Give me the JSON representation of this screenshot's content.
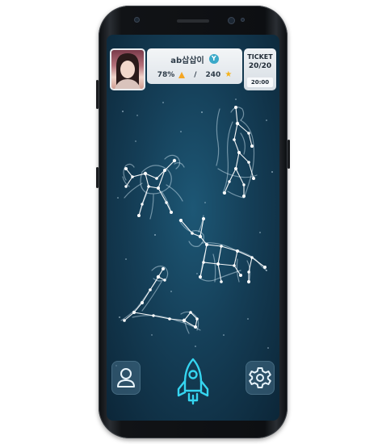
{
  "user": {
    "name": "ab삽삽이",
    "badge_letter": "Y",
    "percent": "78%",
    "separator": "/",
    "stars": "240"
  },
  "ticket": {
    "title": "TICKET",
    "count": "20/20",
    "timer": "20:00"
  },
  "constellations": [
    "cancer-constellation",
    "virgo-constellation",
    "taurus-constellation",
    "sagittarius-constellation"
  ],
  "bottom_nav": {
    "left_icon": "user-icon",
    "center_icon": "rocket-icon",
    "right_icon": "gear-icon"
  },
  "colors": {
    "accent": "#35d5f0",
    "star_gold": "#f5b21a",
    "triangle_orange": "#f5a623",
    "sky_center": "#1d5775",
    "sky_edge": "#0c2638"
  }
}
